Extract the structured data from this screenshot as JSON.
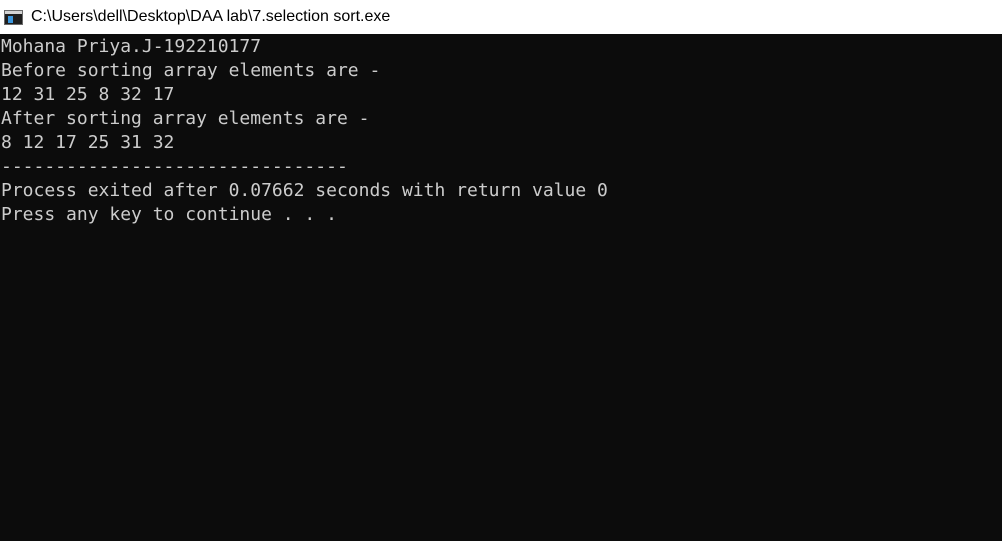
{
  "window": {
    "title": "C:\\Users\\dell\\Desktop\\DAA lab\\7.selection sort.exe",
    "icon": "console-app-icon"
  },
  "console": {
    "lines": [
      "Mohana Priya.J-192210177",
      "Before sorting array elements are -",
      "12 31 25 8 32 17",
      "After sorting array elements are -",
      "8 12 17 25 31 32",
      "--------------------------------",
      "Process exited after 0.07662 seconds with return value 0",
      "Press any key to continue . . ."
    ]
  },
  "colors": {
    "console_background": "#0c0c0c",
    "console_text": "#cccccc",
    "titlebar_background": "#ffffff",
    "titlebar_text": "#000000"
  }
}
